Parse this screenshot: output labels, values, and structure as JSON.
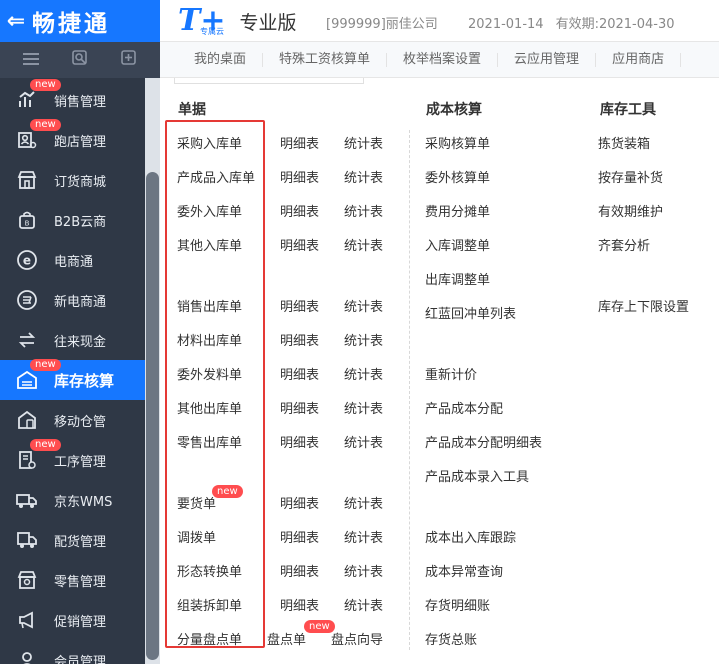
{
  "header": {
    "back_icon": "arrow-left-icon",
    "brand_name": "畅捷通",
    "product_logo": "T+",
    "product_logo_sub": "专属云",
    "edition": "专业版",
    "company": "[999999]丽佳公司",
    "date": "2021-01-14",
    "expiry": "有效期:2021-04-30",
    "accent_color": "#1677ff"
  },
  "toolbar_icons": [
    "menu-icon",
    "search-doc-icon",
    "add-doc-icon"
  ],
  "tabs": [
    "我的桌面",
    "特殊工资核算单",
    "枚举档案设置",
    "云应用管理",
    "应用商店"
  ],
  "sidebar": {
    "items": [
      {
        "label": "销售管理",
        "icon": "chart-icon",
        "badge": "new"
      },
      {
        "label": "跑店管理",
        "icon": "store-person-icon",
        "badge": "new"
      },
      {
        "label": "订货商城",
        "icon": "shop-icon",
        "badge": ""
      },
      {
        "label": "B2B云商",
        "icon": "bag-icon",
        "badge": ""
      },
      {
        "label": "电商通",
        "icon": "e-circle-icon",
        "badge": ""
      },
      {
        "label": "新电商通",
        "icon": "e-circle-icon",
        "badge": ""
      },
      {
        "label": "往来现金",
        "icon": "exchange-icon",
        "badge": ""
      },
      {
        "label": "库存核算",
        "icon": "inventory-icon",
        "badge": "new",
        "active": true
      },
      {
        "label": "移动仓管",
        "icon": "mobile-warehouse-icon",
        "badge": ""
      },
      {
        "label": "工序管理",
        "icon": "process-icon",
        "badge": "new"
      },
      {
        "label": "京东WMS",
        "icon": "truck-icon",
        "badge": ""
      },
      {
        "label": "配货管理",
        "icon": "delivery-icon",
        "badge": ""
      },
      {
        "label": "零售管理",
        "icon": "retail-icon",
        "badge": ""
      },
      {
        "label": "促销管理",
        "icon": "megaphone-icon",
        "badge": ""
      },
      {
        "label": "会员管理",
        "icon": "member-icon",
        "badge": ""
      }
    ]
  },
  "menu": {
    "col1_title": "单据",
    "col2_title": "成本核算",
    "col3_title": "库存工具",
    "detail_label": "明细表",
    "stats_label": "统计表",
    "new_badge": "new",
    "documents": {
      "cgrk": "采购入库单",
      "ccprk": "产成品入库单",
      "wwrk": "委外入库单",
      "qtrk": "其他入库单",
      "xsck": "销售出库单",
      "clck": "材料出库单",
      "wwfl": "委外发料单",
      "qtck": "其他出库单",
      "lsck": "零售出库单",
      "yhd": "要货单",
      "dbd": "调拨单",
      "xtzh": "形态转换单",
      "zzcx": "组装拆卸单",
      "flpd": "分量盘点单",
      "pdd": "盘点单",
      "pdxd": "盘点向导"
    },
    "cost": {
      "c1": "采购核算单",
      "c2": "委外核算单",
      "c3": "费用分摊单",
      "c4": "入库调整单",
      "c5": "出库调整单",
      "c6": "红蓝回冲单列表",
      "c7": "重新计价",
      "c8": "产品成本分配",
      "c9": "产品成本分配明细表",
      "c10": "产品成本录入工具",
      "c11": "成本出入库跟踪",
      "c12": "成本异常查询",
      "c13": "存货明细账",
      "c14": "存货总账"
    },
    "tools": {
      "t1": "拣货装箱",
      "t2": "按存量补货",
      "t3": "有效期维护",
      "t4": "齐套分析",
      "t5": "库存上下限设置"
    },
    "highlight_color": "#e53935"
  }
}
